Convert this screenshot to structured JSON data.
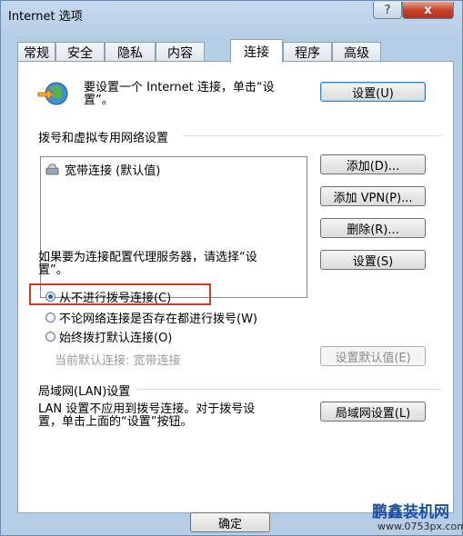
{
  "window": {
    "title": "Internet 选项",
    "help_label": "?",
    "close_label": "x"
  },
  "tabs": [
    {
      "label": "常规"
    },
    {
      "label": "安全"
    },
    {
      "label": "隐私"
    },
    {
      "label": "内容"
    },
    {
      "label": "连接",
      "active": true
    },
    {
      "label": "程序"
    },
    {
      "label": "高级"
    }
  ],
  "setup": {
    "text_line1": "要设置一个 Internet 连接，单击“设",
    "text_line2": "置”。",
    "button": "设置(U)",
    "icon": "network-globe-icon"
  },
  "dialup": {
    "heading": "拨号和虚拟专用网络设置",
    "list_item": "宽带连接 (默认值)",
    "list_item_icon": "broadband-connection-icon",
    "add_button": "添加(D)...",
    "add_vpn_button": "添加 VPN(P)...",
    "remove_button": "删除(R)...",
    "proxy_text_line1": "如果要为连接配置代理服务器，请选择“设",
    "proxy_text_line2": "置”。",
    "settings_button": "设置(S)",
    "options": [
      {
        "label": "从不进行拨号连接(C)",
        "selected": true
      },
      {
        "label": "不论网络连接是否存在都进行拨号(W)",
        "selected": false
      },
      {
        "label": "始终拨打默认连接(O)",
        "selected": false
      }
    ],
    "current_default_label": "当前默认连接:",
    "current_default_value": "宽带连接",
    "set_default_button": "设置默认值(E)"
  },
  "lan": {
    "heading": "局域网(LAN)设置",
    "text_line1": "LAN 设置不应用到拨号连接。对于拨号设",
    "text_line2": "置，单击上面的“设置”按钮。",
    "button": "局域网设置(L)"
  },
  "footer": {
    "ok_button": "确定"
  },
  "watermark": {
    "brand": "鹏鑫装机网",
    "url": "www.0753px.com"
  }
}
